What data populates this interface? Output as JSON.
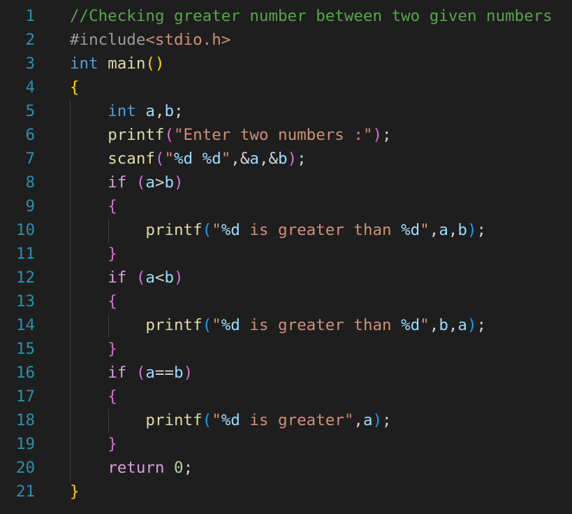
{
  "editor": {
    "language": "C",
    "theme_colors": {
      "background": "#1e1e1e",
      "line_number": "#2b91af",
      "comment": "#57a64a",
      "keyword": "#569cd6",
      "control": "#d8a0df",
      "function": "#dcdcaa",
      "variable": "#9cdcfe",
      "string": "#ce9178",
      "number": "#b5cea8",
      "bracket_level1": "#ffd700",
      "bracket_level2": "#da70d6",
      "bracket_level3": "#179fff"
    },
    "lines": [
      {
        "number": "1",
        "tokens": [
          {
            "t": "//Checking greater number between two given numbers",
            "c": "comment"
          }
        ]
      },
      {
        "number": "2",
        "tokens": [
          {
            "t": "#include",
            "c": "pre"
          },
          {
            "t": "<stdio.h>",
            "c": "str"
          }
        ]
      },
      {
        "number": "3",
        "tokens": [
          {
            "t": "int",
            "c": "keyword"
          },
          {
            "t": " ",
            "c": "punc"
          },
          {
            "t": "main",
            "c": "func"
          },
          {
            "t": "()",
            "c": "b1"
          }
        ]
      },
      {
        "number": "4",
        "tokens": [
          {
            "t": "{",
            "c": "b1"
          }
        ]
      },
      {
        "number": "5",
        "tokens": [
          {
            "t": "    ",
            "c": "punc"
          },
          {
            "t": "int",
            "c": "keyword"
          },
          {
            "t": " ",
            "c": "punc"
          },
          {
            "t": "a",
            "c": "var"
          },
          {
            "t": ",",
            "c": "punc"
          },
          {
            "t": "b",
            "c": "var"
          },
          {
            "t": ";",
            "c": "punc"
          }
        ]
      },
      {
        "number": "6",
        "tokens": [
          {
            "t": "    ",
            "c": "punc"
          },
          {
            "t": "printf",
            "c": "func"
          },
          {
            "t": "(",
            "c": "b2"
          },
          {
            "t": "\"Enter two numbers :\"",
            "c": "str"
          },
          {
            "t": ")",
            "c": "b2"
          },
          {
            "t": ";",
            "c": "punc"
          }
        ]
      },
      {
        "number": "7",
        "tokens": [
          {
            "t": "    ",
            "c": "punc"
          },
          {
            "t": "scanf",
            "c": "func"
          },
          {
            "t": "(",
            "c": "b2"
          },
          {
            "t": "\"",
            "c": "str"
          },
          {
            "t": "%d",
            "c": "esc"
          },
          {
            "t": " ",
            "c": "str"
          },
          {
            "t": "%d",
            "c": "esc"
          },
          {
            "t": "\"",
            "c": "str"
          },
          {
            "t": ",&",
            "c": "punc"
          },
          {
            "t": "a",
            "c": "var"
          },
          {
            "t": ",&",
            "c": "punc"
          },
          {
            "t": "b",
            "c": "var"
          },
          {
            "t": ")",
            "c": "b2"
          },
          {
            "t": ";",
            "c": "punc"
          }
        ]
      },
      {
        "number": "8",
        "tokens": [
          {
            "t": "    ",
            "c": "punc"
          },
          {
            "t": "if",
            "c": "control"
          },
          {
            "t": " ",
            "c": "punc"
          },
          {
            "t": "(",
            "c": "b2"
          },
          {
            "t": "a",
            "c": "var"
          },
          {
            "t": ">",
            "c": "punc"
          },
          {
            "t": "b",
            "c": "var"
          },
          {
            "t": ")",
            "c": "b2"
          }
        ]
      },
      {
        "number": "9",
        "tokens": [
          {
            "t": "    ",
            "c": "punc"
          },
          {
            "t": "{",
            "c": "b2"
          }
        ]
      },
      {
        "number": "10",
        "tokens": [
          {
            "t": "        ",
            "c": "punc"
          },
          {
            "t": "printf",
            "c": "func"
          },
          {
            "t": "(",
            "c": "b3"
          },
          {
            "t": "\"",
            "c": "str"
          },
          {
            "t": "%d",
            "c": "esc"
          },
          {
            "t": " is greater than ",
            "c": "str"
          },
          {
            "t": "%d",
            "c": "esc"
          },
          {
            "t": "\"",
            "c": "str"
          },
          {
            "t": ",",
            "c": "punc"
          },
          {
            "t": "a",
            "c": "var"
          },
          {
            "t": ",",
            "c": "punc"
          },
          {
            "t": "b",
            "c": "var"
          },
          {
            "t": ")",
            "c": "b3"
          },
          {
            "t": ";",
            "c": "punc"
          }
        ]
      },
      {
        "number": "11",
        "tokens": [
          {
            "t": "    ",
            "c": "punc"
          },
          {
            "t": "}",
            "c": "b2"
          }
        ]
      },
      {
        "number": "12",
        "tokens": [
          {
            "t": "    ",
            "c": "punc"
          },
          {
            "t": "if",
            "c": "control"
          },
          {
            "t": " ",
            "c": "punc"
          },
          {
            "t": "(",
            "c": "b2"
          },
          {
            "t": "a",
            "c": "var"
          },
          {
            "t": "<",
            "c": "punc"
          },
          {
            "t": "b",
            "c": "var"
          },
          {
            "t": ")",
            "c": "b2"
          }
        ]
      },
      {
        "number": "13",
        "tokens": [
          {
            "t": "    ",
            "c": "punc"
          },
          {
            "t": "{",
            "c": "b2"
          }
        ]
      },
      {
        "number": "14",
        "tokens": [
          {
            "t": "        ",
            "c": "punc"
          },
          {
            "t": "printf",
            "c": "func"
          },
          {
            "t": "(",
            "c": "b3"
          },
          {
            "t": "\"",
            "c": "str"
          },
          {
            "t": "%d",
            "c": "esc"
          },
          {
            "t": " is greater than ",
            "c": "str"
          },
          {
            "t": "%d",
            "c": "esc"
          },
          {
            "t": "\"",
            "c": "str"
          },
          {
            "t": ",",
            "c": "punc"
          },
          {
            "t": "b",
            "c": "var"
          },
          {
            "t": ",",
            "c": "punc"
          },
          {
            "t": "a",
            "c": "var"
          },
          {
            "t": ")",
            "c": "b3"
          },
          {
            "t": ";",
            "c": "punc"
          }
        ]
      },
      {
        "number": "15",
        "tokens": [
          {
            "t": "    ",
            "c": "punc"
          },
          {
            "t": "}",
            "c": "b2"
          }
        ]
      },
      {
        "number": "16",
        "tokens": [
          {
            "t": "    ",
            "c": "punc"
          },
          {
            "t": "if",
            "c": "control"
          },
          {
            "t": " ",
            "c": "punc"
          },
          {
            "t": "(",
            "c": "b2"
          },
          {
            "t": "a",
            "c": "var"
          },
          {
            "t": "==",
            "c": "punc"
          },
          {
            "t": "b",
            "c": "var"
          },
          {
            "t": ")",
            "c": "b2"
          }
        ]
      },
      {
        "number": "17",
        "tokens": [
          {
            "t": "    ",
            "c": "punc"
          },
          {
            "t": "{",
            "c": "b2"
          }
        ]
      },
      {
        "number": "18",
        "tokens": [
          {
            "t": "        ",
            "c": "punc"
          },
          {
            "t": "printf",
            "c": "func"
          },
          {
            "t": "(",
            "c": "b3"
          },
          {
            "t": "\"",
            "c": "str"
          },
          {
            "t": "%d",
            "c": "esc"
          },
          {
            "t": " is greater\"",
            "c": "str"
          },
          {
            "t": ",",
            "c": "punc"
          },
          {
            "t": "a",
            "c": "var"
          },
          {
            "t": ")",
            "c": "b3"
          },
          {
            "t": ";",
            "c": "punc"
          }
        ]
      },
      {
        "number": "19",
        "tokens": [
          {
            "t": "    ",
            "c": "punc"
          },
          {
            "t": "}",
            "c": "b2"
          }
        ]
      },
      {
        "number": "20",
        "tokens": [
          {
            "t": "    ",
            "c": "punc"
          },
          {
            "t": "return",
            "c": "control"
          },
          {
            "t": " ",
            "c": "punc"
          },
          {
            "t": "0",
            "c": "num"
          },
          {
            "t": ";",
            "c": "punc"
          }
        ]
      },
      {
        "number": "21",
        "tokens": [
          {
            "t": "}",
            "c": "b1"
          }
        ]
      }
    ]
  }
}
